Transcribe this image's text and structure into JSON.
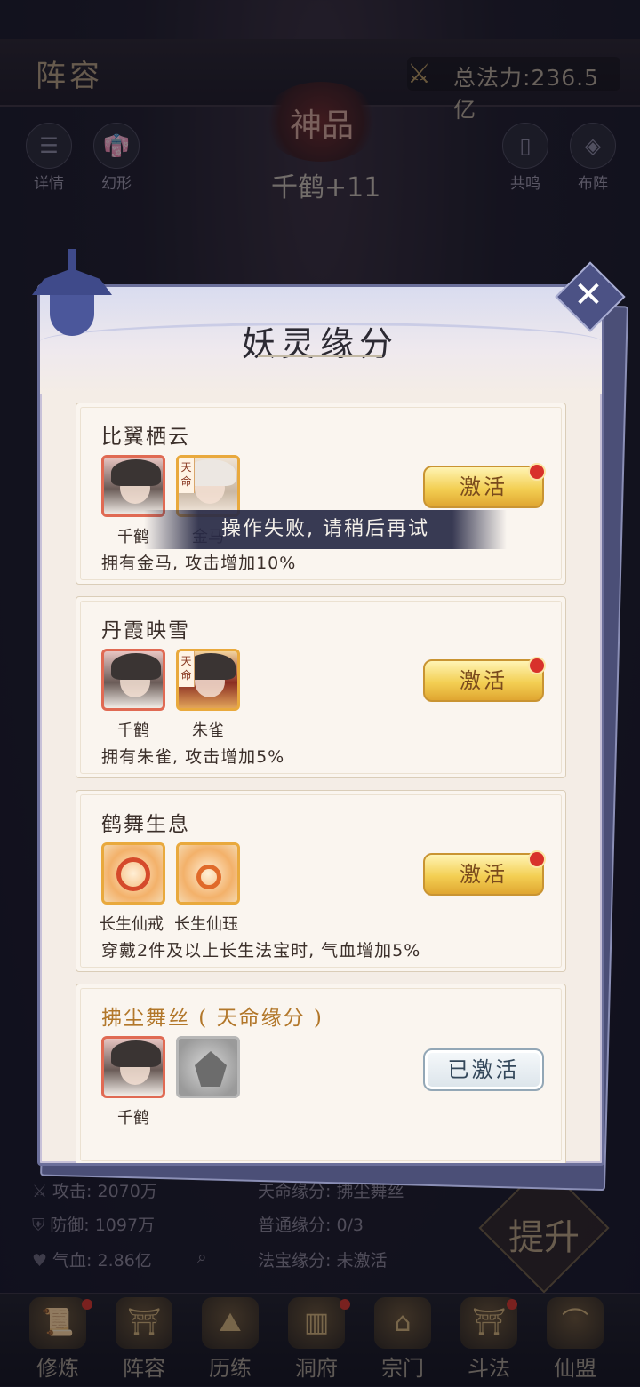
{
  "header": {
    "title": "阵容",
    "power_label": "总法力:236.5亿"
  },
  "hero": {
    "grade": "神品",
    "name": "千鹤+11"
  },
  "side_buttons": {
    "details": "详情",
    "transform": "幻形",
    "resonance": "共鸣",
    "formation": "布阵"
  },
  "stats": {
    "attack": "攻击: 2070万",
    "defense": "防御: 1097万",
    "hp": "气血: 2.86亿",
    "destiny_bond": "天命缘分: 拂尘舞丝",
    "normal_bond": "普通缘分: 0/3",
    "treasure_bond": "法宝缘分: 未激活",
    "ascend": "提升"
  },
  "bottom_nav": [
    {
      "label": "修炼"
    },
    {
      "label": "阵容"
    },
    {
      "label": "历练"
    },
    {
      "label": "洞府"
    },
    {
      "label": "宗门"
    },
    {
      "label": "斗法"
    },
    {
      "label": "仙盟"
    }
  ],
  "modal": {
    "title": "妖灵缘分",
    "close_icon": "close-icon",
    "activate_label": "激活",
    "activated_label": "已激活",
    "cards": [
      {
        "title": "比翼栖云",
        "items": [
          "千鹤",
          "金马"
        ],
        "tag": "天命",
        "description": "拥有金马, 攻击增加10%"
      },
      {
        "title": "丹霞映雪",
        "items": [
          "千鹤",
          "朱雀"
        ],
        "tag": "天命",
        "description": "拥有朱雀, 攻击增加5%"
      },
      {
        "title": "鹤舞生息",
        "items": [
          "长生仙戒",
          "长生仙珏"
        ],
        "description": "穿戴2件及以上长生法宝时, 气血增加5%"
      },
      {
        "title": "拂尘舞丝 ( 天命缘分 )",
        "items": [
          "千鹤"
        ]
      }
    ]
  },
  "toast": "操作失败, 请稍后再试",
  "colors": {
    "accent_gold": "#f3cf53",
    "badge_red": "#d8322b",
    "modal_border": "#6b6f9a"
  }
}
